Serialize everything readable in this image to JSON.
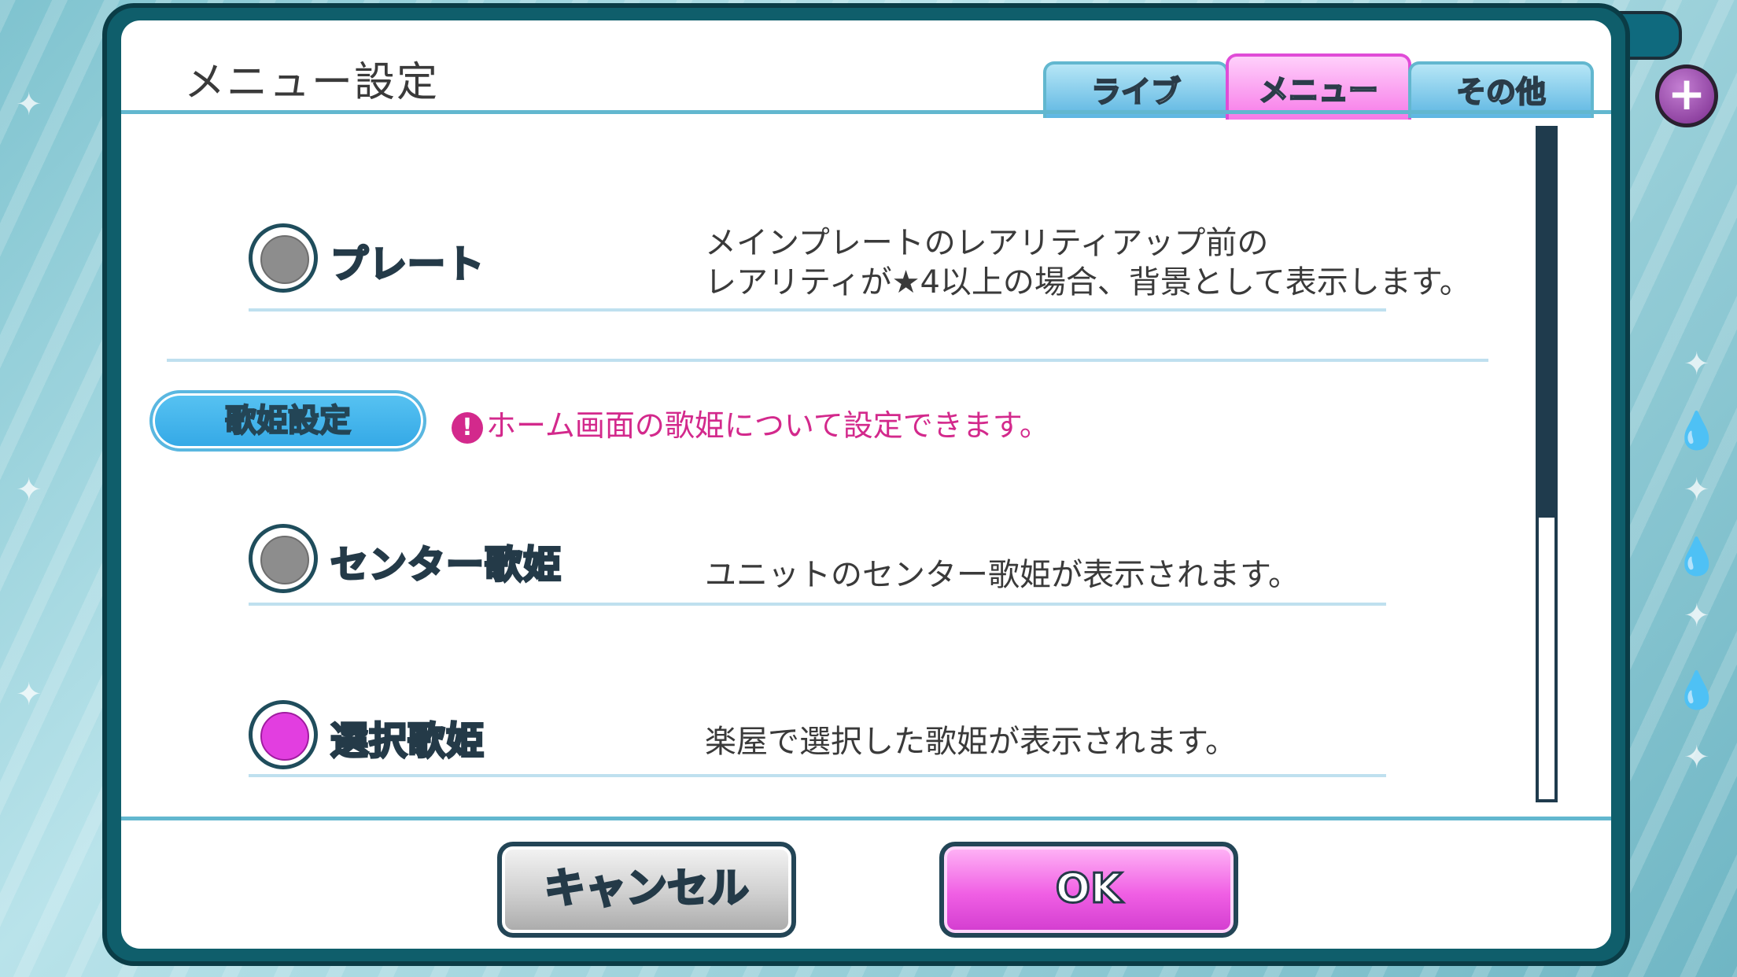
{
  "dialog": {
    "title": "メニュー設定",
    "tabs": [
      {
        "label": "ライブ",
        "active": false
      },
      {
        "label": "メニュー",
        "active": true
      },
      {
        "label": "その他",
        "active": false
      }
    ]
  },
  "options": {
    "plate": {
      "label": "プレート",
      "desc_line1": "メインプレートのレアリティアップ前の",
      "desc_line2": "レアリティが★4以上の場合、背景として表示します。",
      "selected": false
    },
    "center": {
      "label": "センター歌姫",
      "desc": "ユニットのセンター歌姫が表示されます。",
      "selected": false
    },
    "chosen": {
      "label": "選択歌姫",
      "desc": "楽屋で選択した歌姫が表示されます。",
      "selected": true
    }
  },
  "section": {
    "label": "歌姫設定",
    "notice_icon": "!",
    "notice": "ホーム画面の歌姫について設定できます。"
  },
  "buttons": {
    "cancel": "キャンセル",
    "ok": "OK"
  },
  "colors": {
    "accent_pink": "#f05fe4",
    "accent_blue": "#5db6e2",
    "notice": "#d3298c"
  }
}
